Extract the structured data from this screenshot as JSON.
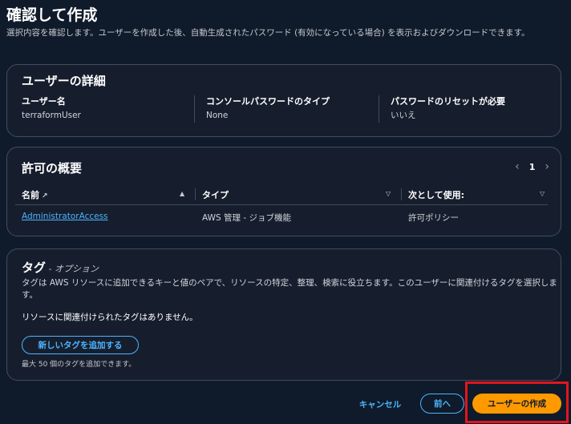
{
  "page": {
    "title": "確認して作成",
    "description": "選択内容を確認します。ユーザーを作成した後、自動生成されたパスワード (有効になっている場合) を表示およびダウンロードできます。"
  },
  "user_details": {
    "heading": "ユーザーの詳細",
    "fields": [
      {
        "label": "ユーザー名",
        "value": "terraformUser"
      },
      {
        "label": "コンソールパスワードのタイプ",
        "value": "None"
      },
      {
        "label": "パスワードのリセットが必要",
        "value": "いいえ"
      }
    ]
  },
  "permissions": {
    "heading": "許可の概要",
    "page_number": "1",
    "columns": [
      "名前",
      "タイプ",
      "次として使用:"
    ],
    "rows": [
      {
        "name": "AdministratorAccess",
        "type": "AWS 管理 - ジョブ機能",
        "used_as": "許可ポリシー"
      }
    ]
  },
  "tags": {
    "heading": "タグ",
    "heading_suffix": " - オプション",
    "description": "タグは AWS リソースに追加できるキーと値のペアで、リソースの特定、整理、検索に役立ちます。このユーザーに関連付けるタグを選択します。",
    "empty_message": "リソースに関連付けられたタグはありません。",
    "add_button": "新しいタグを追加する",
    "limit_note": "最大 50 個のタグを追加できます。"
  },
  "footer": {
    "cancel": "キャンセル",
    "previous": "前へ",
    "create": "ユーザーの作成"
  },
  "colors": {
    "background": "#0f1b2a",
    "panel": "#161e2d",
    "accent_link": "#4cb4ff",
    "primary_button": "#ff9900",
    "highlight": "#e3141e"
  }
}
